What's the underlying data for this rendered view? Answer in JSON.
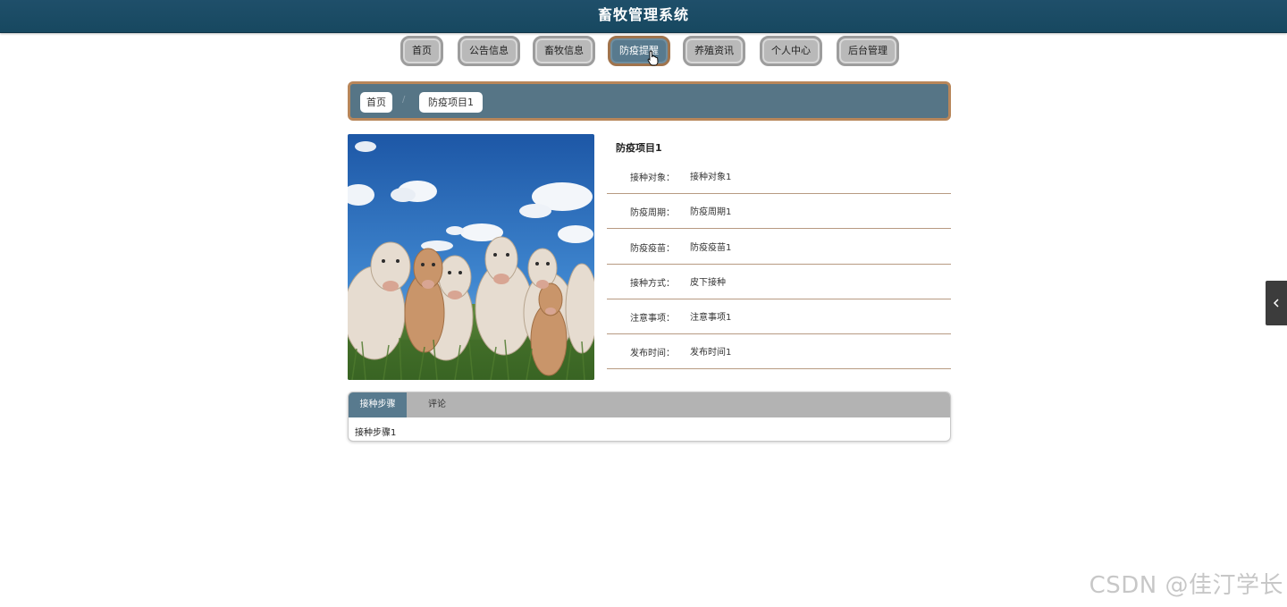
{
  "header": {
    "title": "畜牧管理系统"
  },
  "nav": {
    "items": [
      {
        "label": "首页"
      },
      {
        "label": "公告信息"
      },
      {
        "label": "畜牧信息"
      },
      {
        "label": "防疫提醒"
      },
      {
        "label": "养殖资讯"
      },
      {
        "label": "个人中心"
      },
      {
        "label": "后台管理"
      }
    ],
    "active": "防疫提醒"
  },
  "breadcrumb": {
    "items": [
      {
        "label": "首页"
      },
      {
        "label": "防疫项目1"
      }
    ],
    "separator": "/"
  },
  "image": {
    "subject": "cattle herd on grassland under blue sky"
  },
  "detail": {
    "title": "防疫项目1",
    "fields": [
      {
        "label": "接种对象：",
        "value": "接种对象1"
      },
      {
        "label": "防疫周期：",
        "value": "防疫周期1"
      },
      {
        "label": "防疫疫苗：",
        "value": "防疫疫苗1"
      },
      {
        "label": "接种方式：",
        "value": "皮下接种"
      },
      {
        "label": "注意事项：",
        "value": "注意事项1"
      },
      {
        "label": "发布时间：",
        "value": "发布时间1"
      }
    ]
  },
  "tabs": {
    "items": [
      {
        "label": "接种步骤"
      },
      {
        "label": "评论"
      }
    ],
    "active": "接种步骤",
    "content": "接种步骤1"
  },
  "side_toggle": {
    "icon": "chevron-left-icon"
  },
  "watermark": "CSDN @佳汀学长",
  "colors": {
    "header_bg": "#1f4f6a",
    "active_tab": "#587a8e",
    "accent_border": "#b8865a",
    "nav_button": "#b9b9b9"
  }
}
